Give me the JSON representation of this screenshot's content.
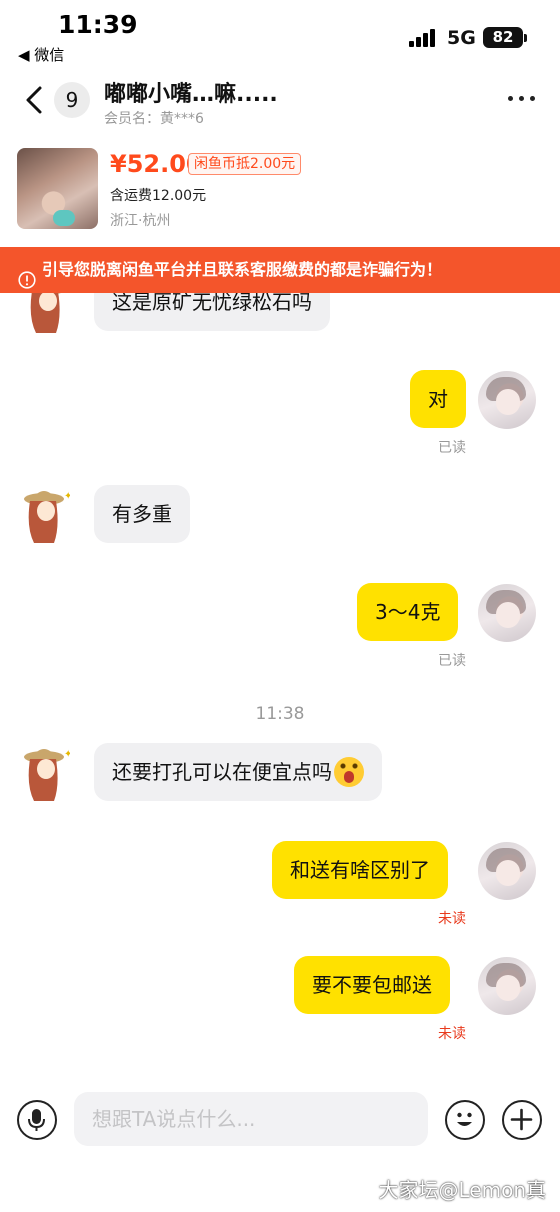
{
  "status_bar": {
    "time": "11:39",
    "back_app": "◀ 微信",
    "network": "5G",
    "battery": "82"
  },
  "header": {
    "unread_count": "9",
    "title": "嘟嘟小嘴…嘛.....",
    "member_name": "会员名：黄***6"
  },
  "product": {
    "price": "¥52.00",
    "coin_discount": "闲鱼币抵2.00元",
    "shipping": "含运费12.00元",
    "location": "浙江·杭州"
  },
  "warning": {
    "text": "引导您脱离闲鱼平台并且联系客服缴费的都是诈骗行为！"
  },
  "messages": [
    {
      "side": "left",
      "text": "这是原矿无忧绿松石吗"
    },
    {
      "side": "right",
      "text": "对",
      "status": "已读"
    },
    {
      "side": "left",
      "text": "有多重"
    },
    {
      "side": "right",
      "text": "3～4克",
      "status": "已读"
    },
    {
      "timestamp": "11:38"
    },
    {
      "side": "left",
      "text": "还要打孔可以在便宜点吗",
      "emoji": "astonished-face"
    },
    {
      "side": "right",
      "text": "和送有啥区别了",
      "status": "未读"
    },
    {
      "side": "right",
      "text": "要不要包邮送",
      "status": "未读"
    }
  ],
  "input": {
    "placeholder": "想跟TA说点什么..."
  },
  "watermark": "大家坛@Lemon真",
  "colors": {
    "accent_orange": "#ff4a1c",
    "warning_bg": "#f4552b",
    "my_bubble": "#ffe100",
    "their_bubble": "#f0f0f2",
    "unread_red": "#e8391c"
  },
  "icons": [
    "back-chevron-icon",
    "more-dots-icon",
    "warning-icon",
    "mic-icon",
    "emoji-icon",
    "plus-icon"
  ]
}
